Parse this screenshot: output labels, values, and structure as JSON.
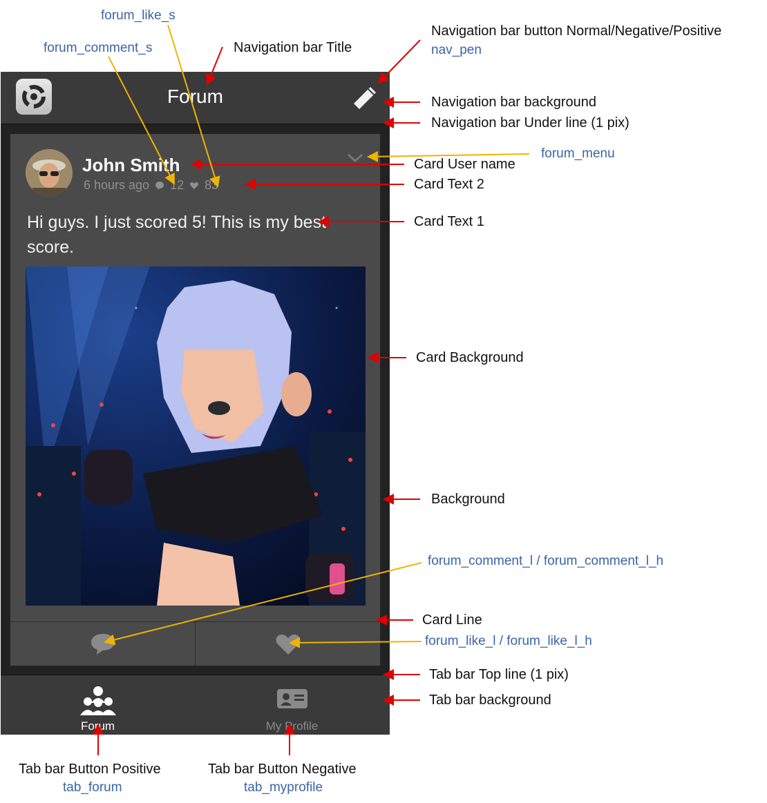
{
  "nav": {
    "title": "Forum"
  },
  "card": {
    "user_name": "John Smith",
    "time": "6 hours ago",
    "comment_count": "12",
    "like_count": "83",
    "text": "Hi guys. I just scored 5! This is my best score."
  },
  "tabs": [
    {
      "label": "Forum",
      "state": "positive"
    },
    {
      "label": "My Profile",
      "state": "negative"
    }
  ],
  "annotations": {
    "forum_like_s": "forum_like_s",
    "forum_comment_s": "forum_comment_s",
    "nav_title": "Navigation bar Title",
    "nav_button": "Navigation bar button Normal/Negative/Positive",
    "nav_pen": "nav_pen",
    "nav_bg": "Navigation bar background",
    "nav_underline": "Navigation bar Under line (1 pix)",
    "forum_menu": "forum_menu",
    "card_user_name": "Card User name",
    "card_text2": "Card Text 2",
    "card_text1": "Card Text 1",
    "card_bg": "Card Background",
    "background": "Background",
    "forum_comment_l": "forum_comment_l / forum_comment_l_h",
    "card_line": "Card Line",
    "forum_like_l": "forum_like_l / forum_like_l_h",
    "tabbar_topline": "Tab bar Top line (1 pix)",
    "tabbar_bg": "Tab bar background",
    "tab_positive": "Tab bar Button Positive",
    "tab_forum": "tab_forum",
    "tab_negative": "Tab bar Button Negative",
    "tab_myprofile": "tab_myprofile"
  },
  "colors": {
    "arrow_red": "#e00000",
    "arrow_yellow": "#f0b400",
    "resource_blue": "#3a64a8",
    "nav_bg": "#3a3a3a",
    "card_bg": "#4a4a4a",
    "background": "#222222"
  },
  "icons": [
    "app-logo-icon",
    "pen-icon",
    "chevron-down-icon",
    "comment-icon",
    "heart-icon",
    "forum-group-icon",
    "profile-card-icon"
  ]
}
